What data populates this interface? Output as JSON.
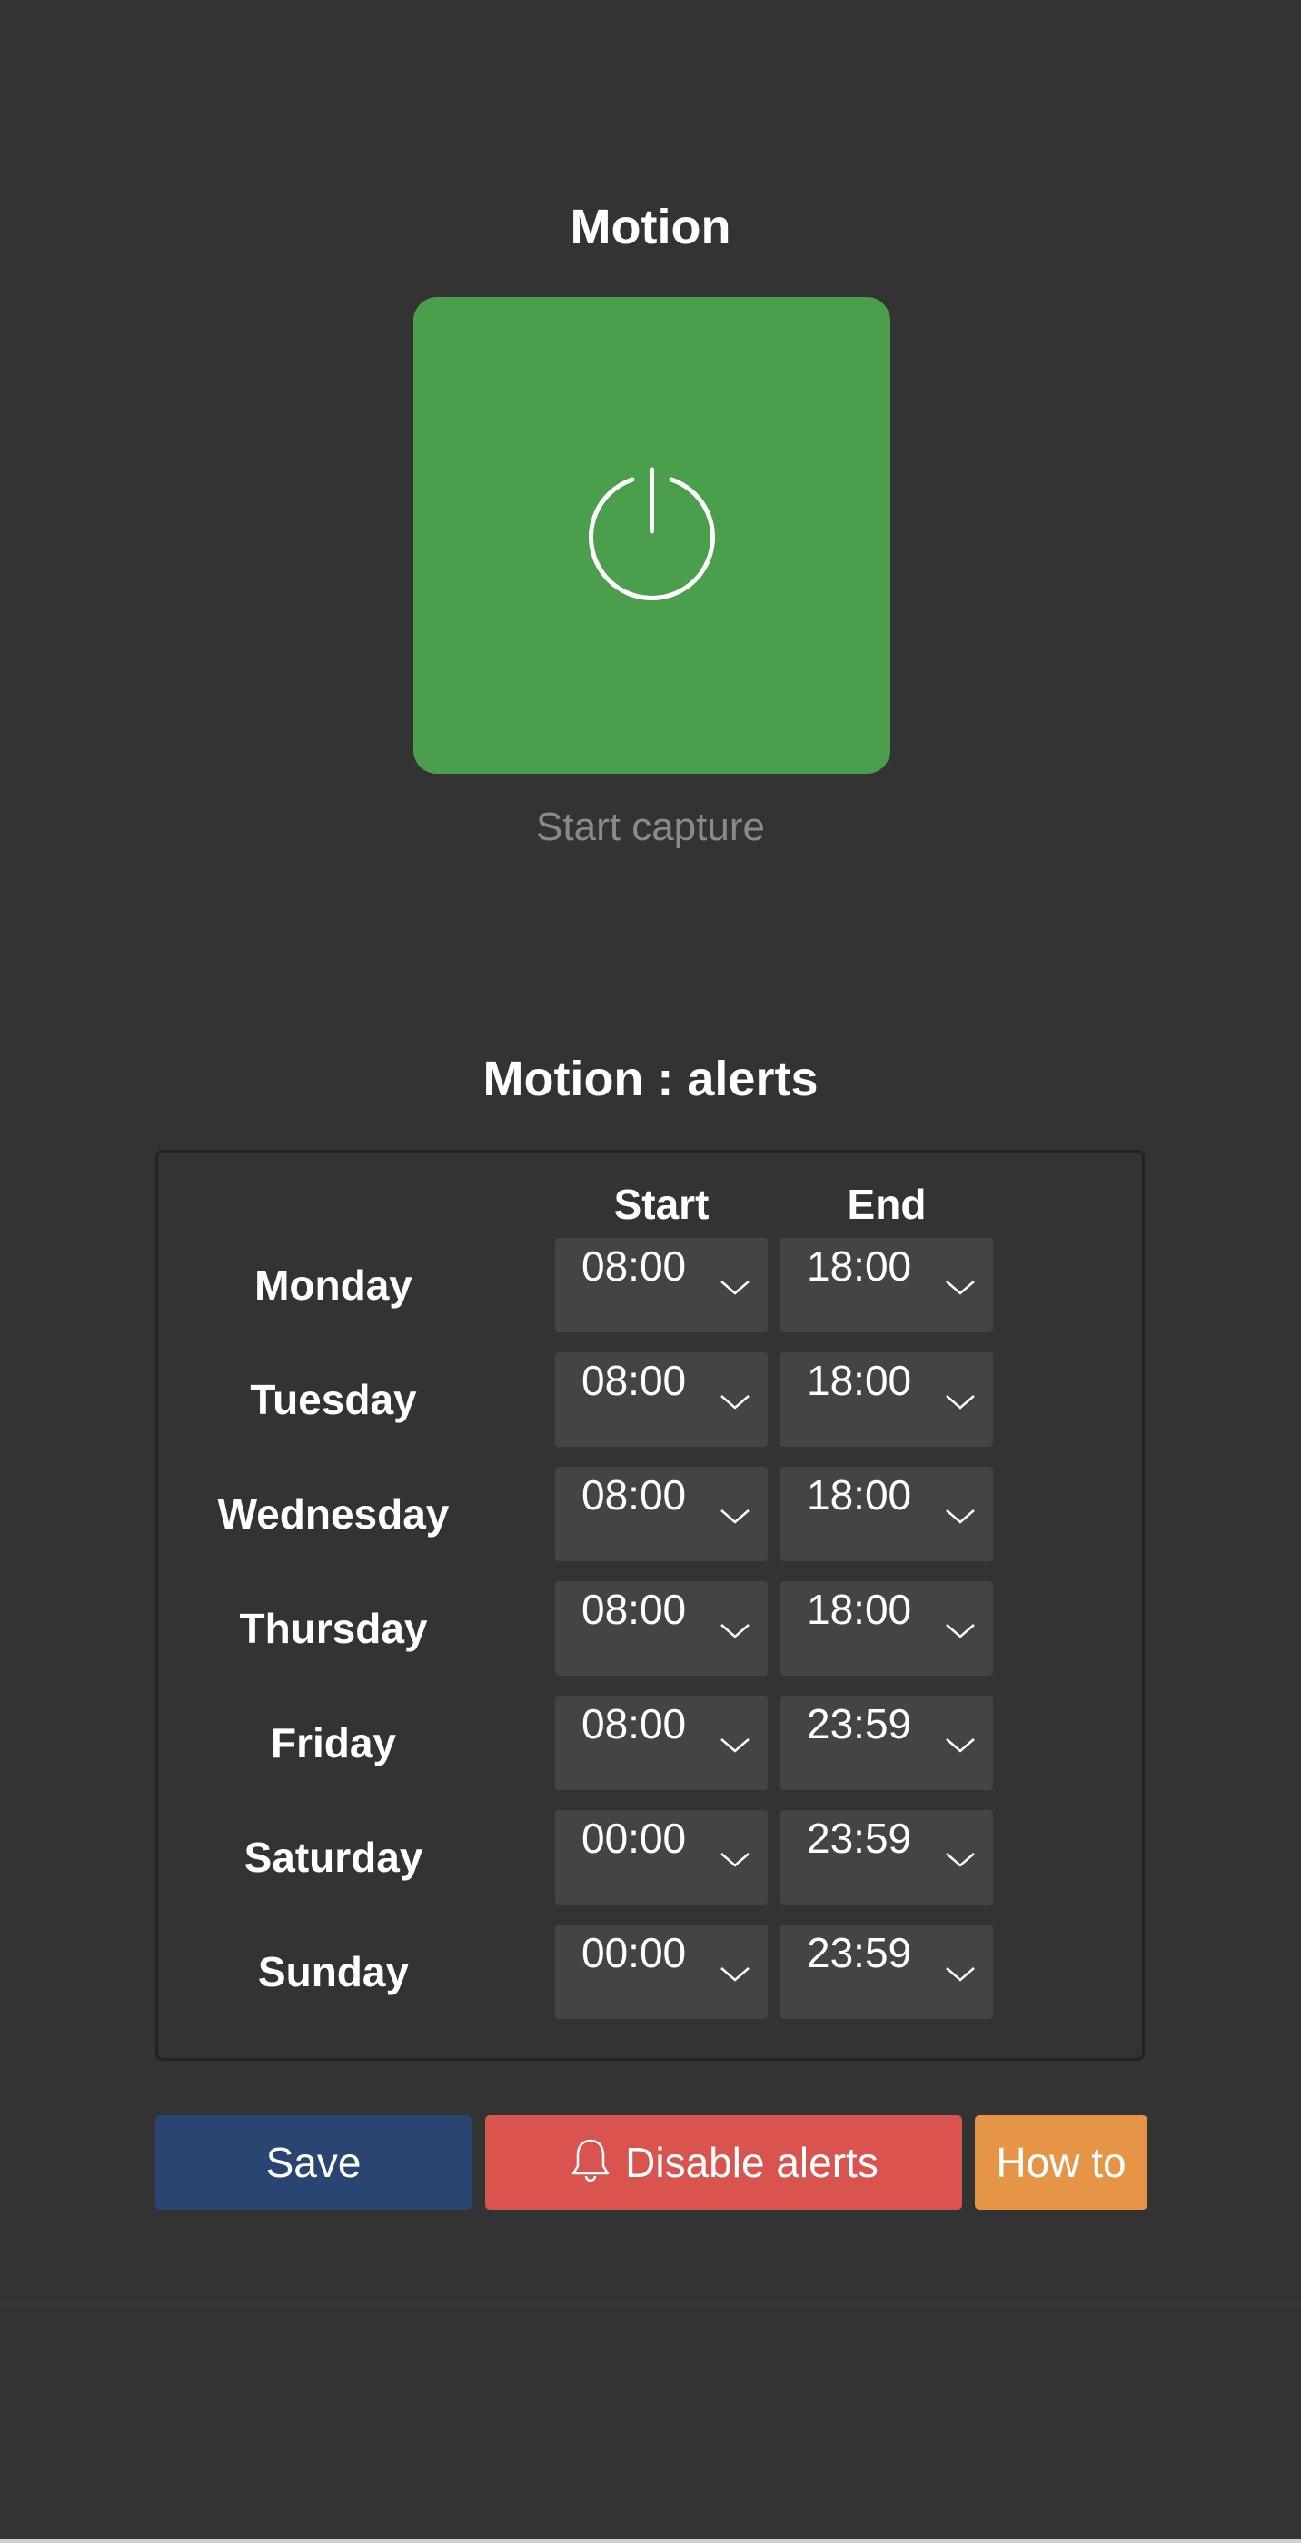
{
  "header": {
    "title": "Motion"
  },
  "capture": {
    "label": "Start capture",
    "icon": "power-icon",
    "color": "#4a9e4c"
  },
  "alerts": {
    "title": "Motion : alerts",
    "columns": {
      "start": "Start",
      "end": "End"
    },
    "days": [
      {
        "day": "Monday",
        "start": "08:00",
        "end": "18:00"
      },
      {
        "day": "Tuesday",
        "start": "08:00",
        "end": "18:00"
      },
      {
        "day": "Wednesday",
        "start": "08:00",
        "end": "18:00"
      },
      {
        "day": "Thursday",
        "start": "08:00",
        "end": "18:00"
      },
      {
        "day": "Friday",
        "start": "08:00",
        "end": "23:59"
      },
      {
        "day": "Saturday",
        "start": "00:00",
        "end": "23:59"
      },
      {
        "day": "Sunday",
        "start": "00:00",
        "end": "23:59"
      }
    ]
  },
  "actions": {
    "save_label": "Save",
    "disable_label": "Disable alerts",
    "disable_icon": "bell-icon",
    "howto_label": "How to",
    "colors": {
      "save": "#2b4573",
      "disable": "#d9534f",
      "howto": "#e69547"
    }
  }
}
